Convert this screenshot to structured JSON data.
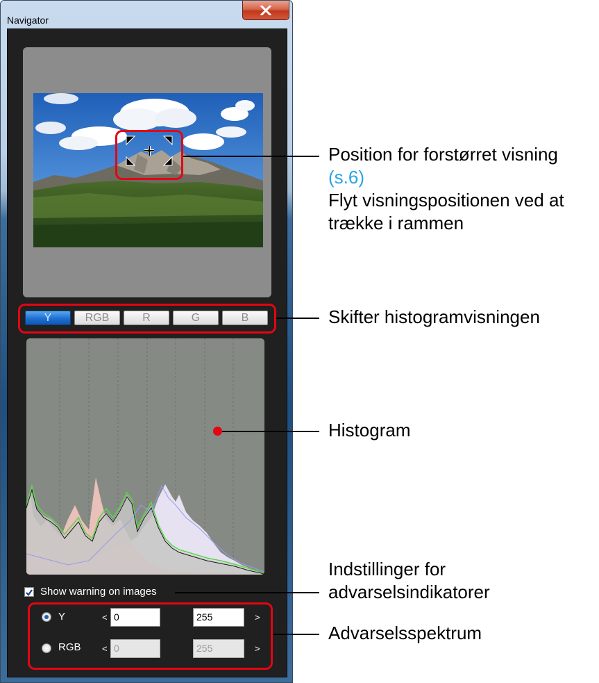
{
  "window": {
    "title": "Navigator"
  },
  "histogram_tabs": [
    {
      "label": "Y",
      "active": true
    },
    {
      "label": "RGB",
      "active": false
    },
    {
      "label": "R",
      "active": false
    },
    {
      "label": "G",
      "active": false
    },
    {
      "label": "B",
      "active": false
    }
  ],
  "warning": {
    "checkbox_label": "Show warning on images",
    "checked": true
  },
  "range": {
    "y": {
      "label": "Y",
      "selected": true,
      "low": "0",
      "high": "255"
    },
    "rgb": {
      "label": "RGB",
      "selected": false,
      "low": "0",
      "high": "255"
    },
    "lt": "<",
    "gt": ">"
  },
  "callouts": {
    "position": {
      "line1": "Position for forstørret visning",
      "link": "(s.6)",
      "line2": "Flyt visningspositionen ved at",
      "line3": "trække i rammen"
    },
    "tabs": "Skifter histogramvisningen",
    "histogram": "Histogram",
    "warning_line1": "Indstillinger for",
    "warning_line2": "advarselsindikatorer",
    "range": "Advarselsspektrum"
  },
  "colors": {
    "accent_red": "#e30613",
    "link_blue": "#2aa3e6",
    "tab_active": "#1f6fd1"
  }
}
